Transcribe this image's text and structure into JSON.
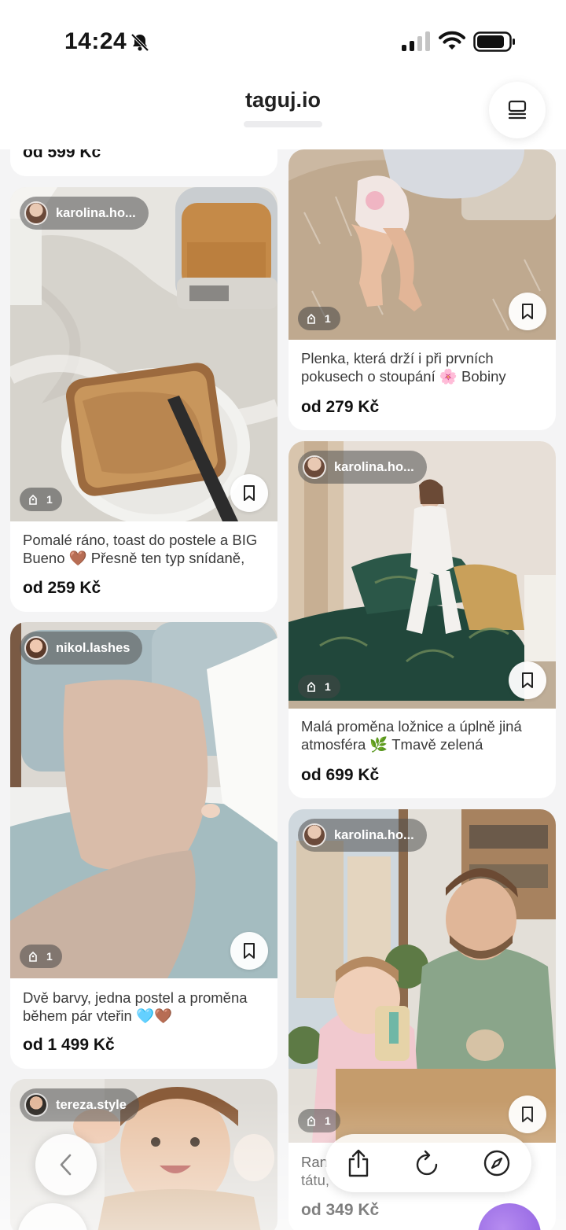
{
  "status_bar": {
    "time": "14:24"
  },
  "header": {
    "title": "taguj.io"
  },
  "feed": {
    "left": [
      {
        "price": "od 599 Kč"
      },
      {
        "author": "karolina.ho...",
        "tag_count": "1",
        "text": "Pomalé ráno, toast do postele a BIG Bueno 🤎 Přesně ten typ snídaně,",
        "price": "od 259 Kč"
      },
      {
        "author": "nikol.lashes",
        "tag_count": "1",
        "text": "Dvě barvy, jedna postel a proměna během pár vteřin 🩵🤎",
        "price": "od 1 499 Kč"
      },
      {
        "author": "tereza.style"
      }
    ],
    "right": [
      {
        "tag_count": "1",
        "text": "Plenka, která drží i při prvních pokusech o stoupání 🌸 Bobiny",
        "price": "od 279 Kč"
      },
      {
        "author": "karolina.ho...",
        "tag_count": "1",
        "text": "Malá proměna ložnice a úplně jiná atmosféra 🌿 Tmavě zelená",
        "price": "od 699 Kč"
      },
      {
        "author": "karolina.ho...",
        "tag_count": "1",
        "text_partial_1": "Ran",
        "text_partial_2": "tátu,",
        "price": "od 349 Kč"
      }
    ]
  },
  "colors": {
    "accent": "#8d5ee0",
    "background": "#f4f4f5",
    "card": "#ffffff"
  }
}
